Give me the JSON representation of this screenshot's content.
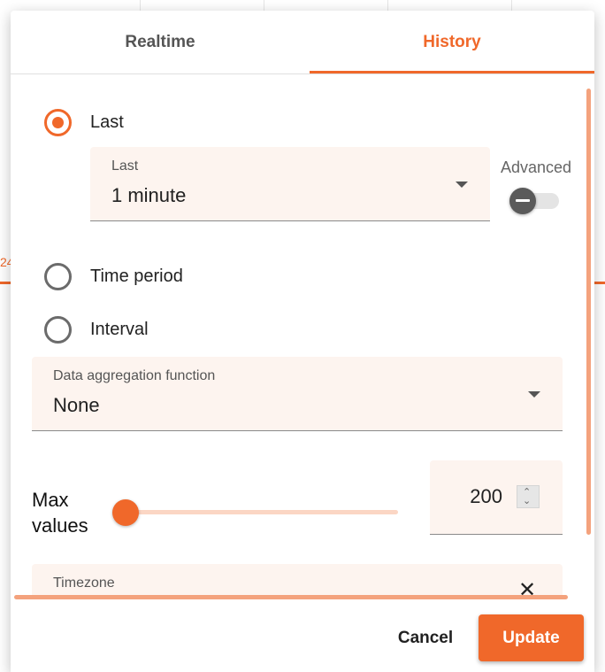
{
  "tabs": [
    {
      "label": "Realtime",
      "active": false
    },
    {
      "label": "History",
      "active": true
    }
  ],
  "history": {
    "mode_last_label": "Last",
    "last_field_label": "Last",
    "last_field_value": "1 minute",
    "advanced_label": "Advanced",
    "advanced_enabled": false,
    "mode_time_period_label": "Time period",
    "mode_interval_label": "Interval",
    "selected_mode": "Last"
  },
  "aggregation": {
    "label": "Data aggregation function",
    "value": "None"
  },
  "max_values": {
    "label_line1": "Max",
    "label_line2": "values",
    "value": "200"
  },
  "timezone": {
    "label": "Timezone"
  },
  "background": {
    "axis_tick": "24"
  },
  "actions": {
    "cancel_label": "Cancel",
    "update_label": "Update"
  },
  "colors": {
    "accent": "#f0682a",
    "field_bg": "#fdf4ef",
    "slider_track": "#fbd6c4"
  },
  "icons": {
    "dropdown": "chevron-down-icon",
    "close": "close-icon",
    "spinner": "spinner-arrows-icon"
  }
}
